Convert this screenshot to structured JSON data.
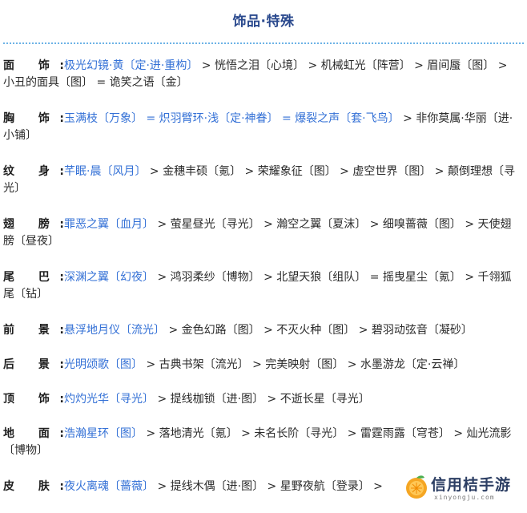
{
  "title": "饰品·特殊",
  "rows": [
    {
      "label": "面 饰:",
      "segments": [
        {
          "text": "极光幻镜·黄〔定·进·重构〕",
          "blue": true
        },
        {
          "text": " > 恍悟之泪〔心境〕 > 机械虹光〔阵营〕 > 眉间蜃〔图〕 > 小丑的面具〔图〕 = 诡笑之语〔金〕",
          "blue": false
        }
      ]
    },
    {
      "label": "胸 饰:",
      "segments": [
        {
          "text": "玉满枝〔万象〕 = 炽羽臂环·浅〔定·神眷〕 = 爆裂之声〔套·飞鸟〕",
          "blue": true
        },
        {
          "text": " > 非你莫属·华丽〔进·小铺〕",
          "blue": false
        }
      ]
    },
    {
      "label": "纹 身:",
      "segments": [
        {
          "text": "芊眠·晨〔风月〕",
          "blue": true
        },
        {
          "text": " > 金穗丰硕〔氪〕 > 荣耀象征〔图〕 > 虚空世界〔图〕 > 颠倒理想〔寻光〕",
          "blue": false
        }
      ]
    },
    {
      "label": "翅 膀:",
      "segments": [
        {
          "text": "罪恶之翼〔血月〕",
          "blue": true
        },
        {
          "text": " > 萤星昼光〔寻光〕 > 瀚空之翼〔夏沫〕 > 细嗅蔷薇〔图〕 > 天使翅膀〔昼夜〕",
          "blue": false
        }
      ]
    },
    {
      "label": "尾 巴:",
      "segments": [
        {
          "text": "深渊之翼〔幻夜〕",
          "blue": true
        },
        {
          "text": " > 鸿羽柔纱〔博物〕 > 北望天狼〔组队〕 = 摇曳星尘〔氪〕 > 千翎狐尾〔钻〕",
          "blue": false
        }
      ]
    },
    {
      "label": "前 景:",
      "segments": [
        {
          "text": "悬浮地月仪〔流光〕",
          "blue": true
        },
        {
          "text": " > 金色幻路〔图〕 > 不灭火种〔图〕 > 碧羽动弦音〔凝砂〕",
          "blue": false
        }
      ]
    },
    {
      "label": "后 景:",
      "segments": [
        {
          "text": "光明颂歌〔图〕",
          "blue": true
        },
        {
          "text": " > 古典书架〔流光〕 > 完美映射〔图〕 > 水墨游龙〔定·云禅〕",
          "blue": false
        }
      ]
    },
    {
      "label": "顶 饰:",
      "segments": [
        {
          "text": "灼灼光华〔寻光〕",
          "blue": true
        },
        {
          "text": " > 提线枷锁〔进·图〕 > 不逝长星〔寻光〕",
          "blue": false
        }
      ]
    },
    {
      "label": "地 面:",
      "segments": [
        {
          "text": "浩瀚星环〔图〕",
          "blue": true
        },
        {
          "text": " > 落地清光〔氪〕 > 未名长阶〔寻光〕 > 雷霆雨露〔穹苍〕 > 灿光流影〔博物〕",
          "blue": false
        }
      ]
    },
    {
      "label": "皮 肤:",
      "segments": [
        {
          "text": "夜火离魂〔蔷薇〕",
          "blue": true
        },
        {
          "text": " > 提线木偶〔进·图〕 > 星野夜航〔登录〕 > ",
          "blue": false
        }
      ]
    }
  ],
  "watermark": {
    "text": "信用桔手游",
    "url": "xinyongju.com",
    "icon": "orange-logo-icon"
  },
  "colors": {
    "title": "#2b4a8e",
    "highlight": "#3370d6",
    "divider": "#6db3e6"
  }
}
